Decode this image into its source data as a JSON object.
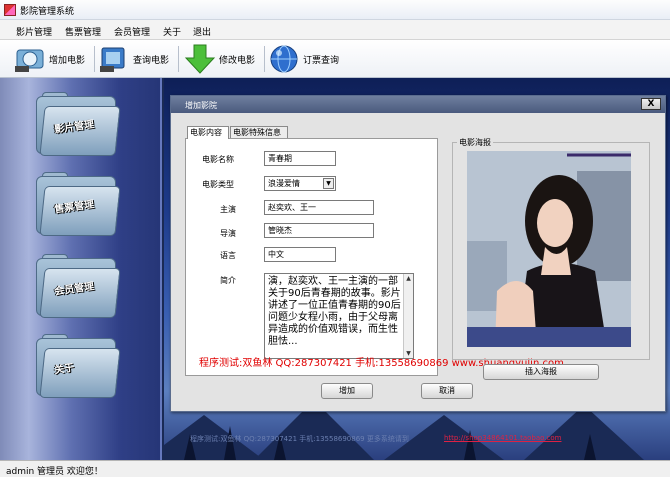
{
  "window": {
    "title": "影院管理系统"
  },
  "menu": [
    {
      "label": "影片管理"
    },
    {
      "label": "售票管理"
    },
    {
      "label": "会员管理"
    },
    {
      "label": "关于"
    },
    {
      "label": "退出"
    }
  ],
  "toolbar": [
    {
      "label": "增加电影",
      "icon": "add-movie-icon"
    },
    {
      "label": "查询电影",
      "icon": "search-movie-icon"
    },
    {
      "label": "修改电影",
      "icon": "down-arrow-icon"
    },
    {
      "label": "订票查询",
      "icon": "globe-icon"
    }
  ],
  "leftnav": [
    {
      "label": "影片管理"
    },
    {
      "label": "售票管理"
    },
    {
      "label": "会员管理"
    },
    {
      "label": "关于"
    }
  ],
  "dialog": {
    "title": "增加影院",
    "close": "X",
    "tabs": [
      {
        "label": "电影内容",
        "active": true
      },
      {
        "label": "电影特殊信息",
        "active": false
      }
    ],
    "form": {
      "name_label": "电影名称",
      "name_value": "青春期",
      "type_label": "电影类型",
      "type_value": "浪漫爱情",
      "lead_label": "主演",
      "lead_value": "赵奕欢、王一",
      "director_label": "导演",
      "director_value": "管晓杰",
      "language_label": "语言",
      "language_value": "中文",
      "intro_label": "简介",
      "intro_value": "演，赵奕欢、王一主演的一部关于90后青春期的故事。影片讲述了一位正值青春期的90后问题少女程小雨，由于父母离异造成的价值观错误，而生性胆怯..."
    },
    "poster_label": "电影海报",
    "insert_poster": "插入海报",
    "add_button": "增加",
    "cancel_button": "取消"
  },
  "overlay_text": "程序测试:双鱼林 QQ:287307421 手机:13558690869 www.shuangyulin.com",
  "bottom_text": "程序测试:双鱼林 QQ:287307421 手机:13558690869 更多系统请到",
  "bottom_link": "http://shop34864101.taobao.com",
  "status": "admin  管理员  欢迎您！"
}
